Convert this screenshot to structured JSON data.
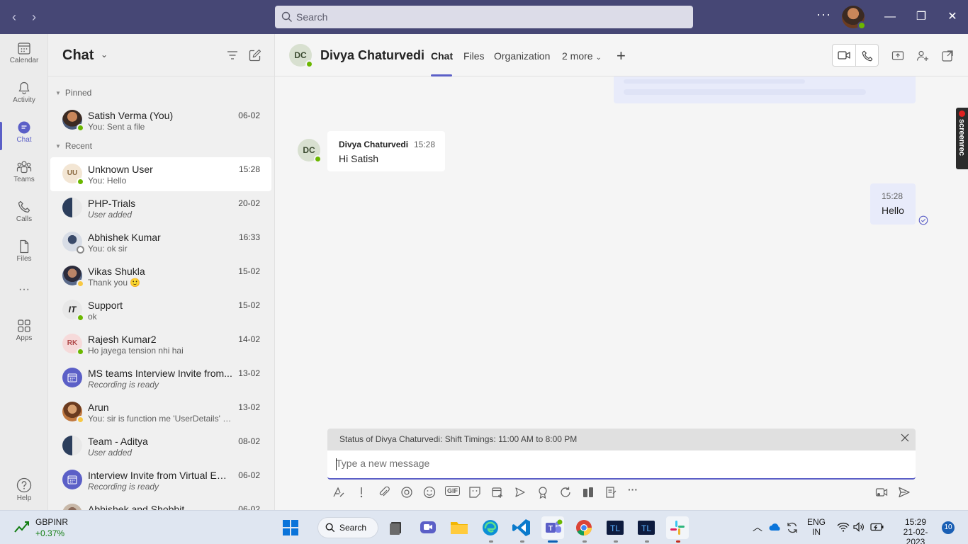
{
  "titlebar": {
    "search_placeholder": "Search",
    "more_label": "···",
    "minimize_label": "—",
    "restore_label": "❐",
    "close_label": "✕"
  },
  "rail": {
    "items": [
      {
        "label": "Calendar",
        "icon": "calendar-icon"
      },
      {
        "label": "Activity",
        "icon": "bell-icon"
      },
      {
        "label": "Chat",
        "icon": "chat-icon",
        "active": true
      },
      {
        "label": "Teams",
        "icon": "teams-icon"
      },
      {
        "label": "Calls",
        "icon": "phone-icon"
      },
      {
        "label": "Files",
        "icon": "file-icon"
      },
      {
        "label": "Apps",
        "icon": "apps-icon"
      },
      {
        "label": "Help",
        "icon": "help-icon"
      }
    ],
    "more_label": "···"
  },
  "chatlist": {
    "title": "Chat",
    "chevron": "⌄",
    "pinned_label": "Pinned",
    "recent_label": "Recent",
    "pinned": [
      {
        "name": "Satish Verma (You)",
        "preview": "You: Sent a file",
        "time": "06-02",
        "initials": "",
        "status": "green"
      }
    ],
    "recent": [
      {
        "name": "Unknown User",
        "preview": "You: Hello",
        "time": "15:28",
        "initials": "UU",
        "status": "green",
        "selected": true
      },
      {
        "name": "PHP-Trials",
        "preview": "User added",
        "time": "20-02",
        "initials": "",
        "italic": true
      },
      {
        "name": "Abhishek Kumar",
        "preview": "You: ok sir",
        "time": "16:33",
        "initials": "",
        "status": "grey"
      },
      {
        "name": "Vikas Shukla",
        "preview": "Thank you 🙂",
        "time": "15-02",
        "initials": "",
        "status": "yellow"
      },
      {
        "name": "Support",
        "preview": "ok",
        "time": "15-02",
        "initials": "IT",
        "status": "green"
      },
      {
        "name": "Rajesh Kumar2",
        "preview": "Ho jayega tension nhi hai",
        "time": "14-02",
        "initials": "RK",
        "status": "green"
      },
      {
        "name": "MS teams Interview Invite from...",
        "preview": "Recording is ready",
        "time": "13-02",
        "initials": "",
        "italic": true
      },
      {
        "name": "Arun",
        "preview": "You: sir is function me 'UserDetails' obje...",
        "time": "13-02",
        "initials": "",
        "status": "yellow"
      },
      {
        "name": "Team - Aditya",
        "preview": "User added",
        "time": "08-02",
        "initials": "",
        "italic": true
      },
      {
        "name": "Interview Invite from Virtual Em...",
        "preview": "Recording is ready",
        "time": "06-02",
        "initials": "",
        "italic": true
      },
      {
        "name": "Abhishek and Shobhit",
        "preview": "",
        "time": "06-02",
        "initials": ""
      }
    ]
  },
  "header": {
    "initials": "DC",
    "name": "Divya Chaturvedi",
    "tabs": [
      "Chat",
      "Files",
      "Organization",
      "2 more"
    ],
    "add_tab_label": "+"
  },
  "conversation": {
    "incoming": {
      "initials": "DC",
      "sender": "Divya Chaturvedi",
      "time": "15:28",
      "text": "Hi Satish"
    },
    "outgoing": {
      "time": "15:28",
      "text": "Hello"
    },
    "screenrec_label": "screenrec"
  },
  "compose": {
    "status_text": "Status of Divya Chaturvedi: Shift Timings: 11:00 AM to 8:00 PM",
    "placeholder": "Type a new message",
    "gif_label": "GIF",
    "more_label": "···"
  },
  "taskbar": {
    "ticker": "GBPINR",
    "delta": "+0.37%",
    "search_label": "Search",
    "lang_top": "ENG",
    "lang_bottom": "IN",
    "time": "15:29",
    "date": "21-02-2023",
    "notifications": "10"
  },
  "colors": {
    "titlebar": "#464775",
    "accent": "#5b5fc7",
    "online": "#6bb700",
    "away": "#f8c843"
  }
}
